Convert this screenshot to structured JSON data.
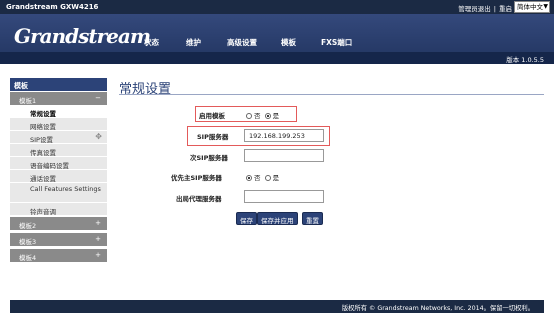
{
  "topbar": {
    "brand": "Grandstream GXW4216",
    "admin_logout": "管理员退出",
    "separator": "|",
    "reboot": "重启",
    "language": "简体中文"
  },
  "header": {
    "logo_text": "Grandstream",
    "nav": [
      "状态",
      "维护",
      "高级设置",
      "模板",
      "FXS端口"
    ]
  },
  "version": "版本 1.0.5.5",
  "sidebar": {
    "heading": "模板",
    "groups": [
      {
        "label": "模板1",
        "symbol": "−"
      },
      {
        "label": "模板2",
        "symbol": "+"
      },
      {
        "label": "模板3",
        "symbol": "+"
      },
      {
        "label": "模板4",
        "symbol": "+"
      }
    ],
    "items": [
      {
        "label": "常规设置"
      },
      {
        "label": "网络设置"
      },
      {
        "label": "SIP设置"
      },
      {
        "label": "传真设置"
      },
      {
        "label": "语音编码设置"
      },
      {
        "label": "通话设置"
      },
      {
        "label": "Call Features Settings"
      },
      {
        "label": "铃声音调"
      }
    ]
  },
  "main": {
    "title": "常规设置",
    "fields": {
      "enable_template": {
        "label": "启用模板",
        "options": [
          "否",
          "是"
        ],
        "selected": "是"
      },
      "sip_server": {
        "label": "SIP服务器",
        "value": "192.168.199.253"
      },
      "secondary_sip_server": {
        "label": "次SIP服务器",
        "value": ""
      },
      "prefer_primary_sip": {
        "label": "优先主SIP服务器",
        "options": [
          "否",
          "是"
        ],
        "selected": "否"
      },
      "outbound_proxy": {
        "label": "出局代理服务器",
        "value": ""
      }
    },
    "buttons": {
      "save": "保存",
      "save_apply": "保存并应用",
      "reset": "重置"
    }
  },
  "footer": "版权所有 © Grandstream Networks, Inc. 2014。保留一切权利。",
  "colors": {
    "navy": "#1b2a44",
    "accent": "#2c4378",
    "highlight": "#e35a5a"
  }
}
